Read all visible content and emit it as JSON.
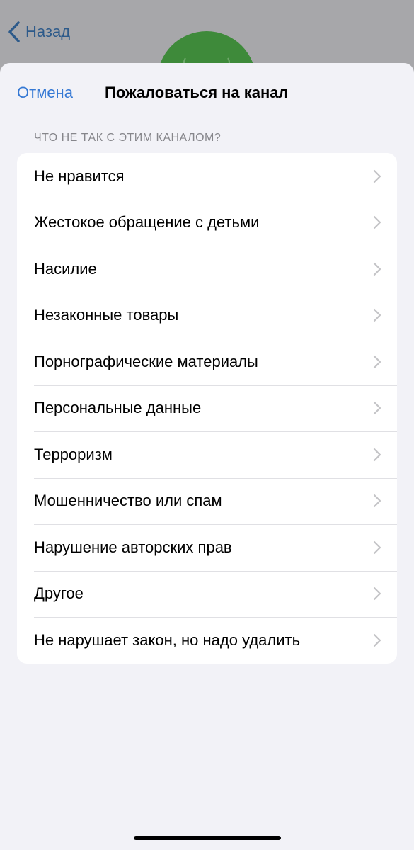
{
  "background": {
    "back_label": "Назад"
  },
  "sheet": {
    "cancel_label": "Отмена",
    "title": "Пожаловаться на канал",
    "section_header": "ЧТО НЕ ТАК С ЭТИМ КАНАЛОМ?",
    "items": [
      {
        "label": "Не нравится"
      },
      {
        "label": "Жестокое обращение с детьми"
      },
      {
        "label": "Насилие"
      },
      {
        "label": "Незаконные товары"
      },
      {
        "label": "Порнографические материалы"
      },
      {
        "label": "Персональные данные"
      },
      {
        "label": "Терроризм"
      },
      {
        "label": "Мошенничество или спам"
      },
      {
        "label": "Нарушение авторских прав"
      },
      {
        "label": "Другое"
      },
      {
        "label": "Не нарушает закон, но надо удалить"
      }
    ]
  },
  "colors": {
    "accent": "#3478d4",
    "sheet_background": "#f2f2f7",
    "group_background": "#ffffff",
    "chevron": "#c4c4c7",
    "avatar_green": "#3e8a3a"
  },
  "icons": {
    "back": "chevron-left-icon",
    "row": "chevron-right-icon"
  }
}
